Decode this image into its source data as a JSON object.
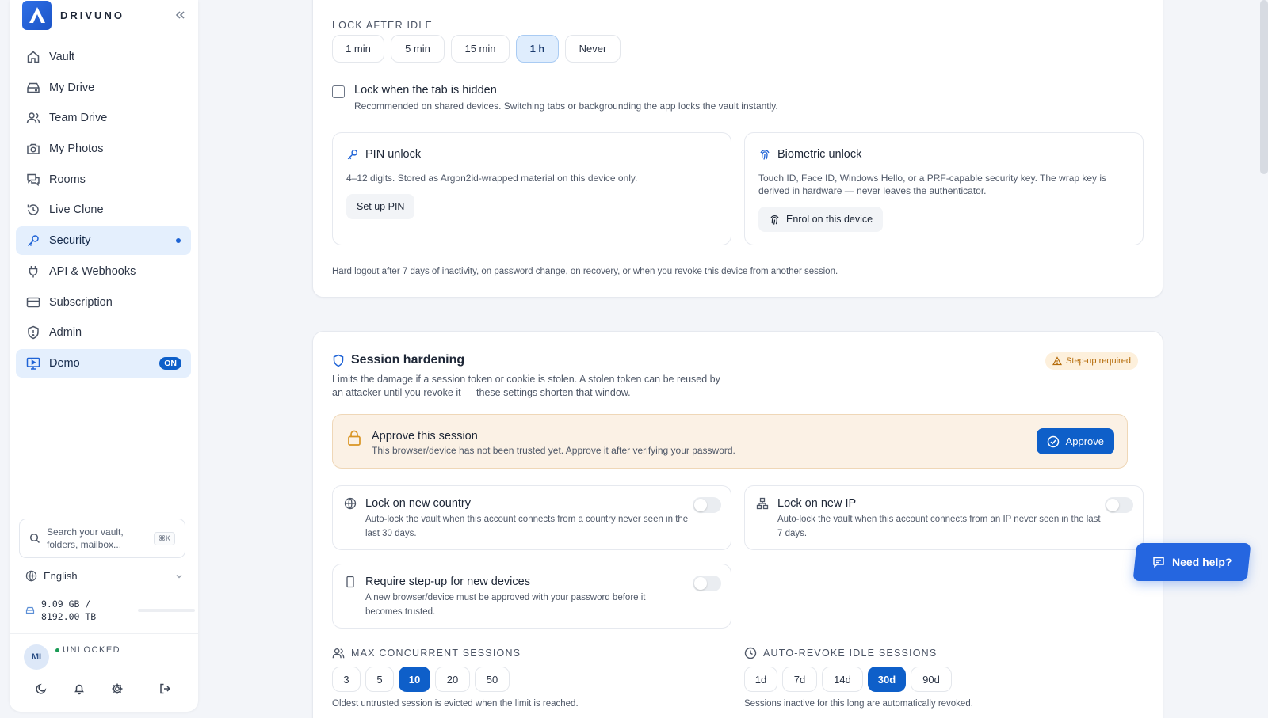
{
  "brand": {
    "name": "DRIVUNO"
  },
  "sidebar": {
    "items": [
      {
        "label": "Vault",
        "icon": "home-icon"
      },
      {
        "label": "My Drive",
        "icon": "drive-icon"
      },
      {
        "label": "Team Drive",
        "icon": "users-icon"
      },
      {
        "label": "My Photos",
        "icon": "camera-icon"
      },
      {
        "label": "Rooms",
        "icon": "chat-icon"
      },
      {
        "label": "Live Clone",
        "icon": "history-icon"
      },
      {
        "label": "Security",
        "icon": "key-icon",
        "active": true
      },
      {
        "label": "API & Webhooks",
        "icon": "plug-icon"
      },
      {
        "label": "Subscription",
        "icon": "card-icon"
      },
      {
        "label": "Admin",
        "icon": "shield-icon"
      },
      {
        "label": "Demo",
        "icon": "monitor-icon",
        "badge": "ON"
      }
    ],
    "search": {
      "text": "Search your vault, folders, mailbox...",
      "shortcut": "⌘K"
    },
    "language": "English",
    "storage": {
      "line1": "9.09 GB /",
      "line2": "8192.00 TB",
      "fraction": 0.0
    },
    "user": {
      "initials": "MI",
      "status": "UNLOCKED"
    }
  },
  "lock": {
    "caption": "LOCK AFTER IDLE",
    "options": [
      "1 min",
      "5 min",
      "15 min",
      "1 h",
      "Never"
    ],
    "selected": "1 h",
    "tab_hidden": {
      "title": "Lock when the tab is hidden",
      "desc": "Recommended on shared devices. Switching tabs or backgrounding the app locks the vault instantly.",
      "checked": false
    },
    "pin": {
      "title": "PIN unlock",
      "desc": "4–12 digits. Stored as Argon2id-wrapped material on this device only.",
      "button": "Set up PIN"
    },
    "bio": {
      "title": "Biometric unlock",
      "desc": "Touch ID, Face ID, Windows Hello, or a PRF-capable security key. The wrap key is derived in hardware — never leaves the authenticator.",
      "button": "Enrol on this device"
    },
    "footer": "Hard logout after 7 days of inactivity, on password change, on recovery, or when you revoke this device from another session."
  },
  "session": {
    "title": "Session hardening",
    "badge": "Step-up required",
    "desc": "Limits the damage if a session token or cookie is stolen. A stolen token can be reused by an attacker until you revoke it — these settings shorten that window.",
    "approve": {
      "title": "Approve this session",
      "desc": "This browser/device has not been trusted yet. Approve it after verifying your password.",
      "button": "Approve"
    },
    "country": {
      "title": "Lock on new country",
      "desc": "Auto-lock the vault when this account connects from a country never seen in the last 30 days.",
      "enabled": false
    },
    "ip": {
      "title": "Lock on new IP",
      "desc": "Auto-lock the vault when this account connects from an IP never seen in the last 7 days.",
      "enabled": false
    },
    "stepup": {
      "title": "Require step-up for new devices",
      "desc": "A new browser/device must be approved with your password before it becomes trusted.",
      "enabled": false
    },
    "max_sessions": {
      "caption": "MAX CONCURRENT SESSIONS",
      "options": [
        "3",
        "5",
        "10",
        "20",
        "50"
      ],
      "selected": "10",
      "note": "Oldest untrusted session is evicted when the limit is reached."
    },
    "revoke": {
      "caption": "AUTO-REVOKE IDLE SESSIONS",
      "options": [
        "1d",
        "7d",
        "14d",
        "30d",
        "90d"
      ],
      "selected": "30d",
      "note": "Sessions inactive for this long are automatically revoked."
    }
  },
  "help": {
    "label": "Need help?"
  },
  "colors": {
    "accent": "#0e5fc9",
    "active_bg": "#e4effd",
    "warn_bg": "#fbf1e5",
    "warn_text": "#b56b09"
  }
}
